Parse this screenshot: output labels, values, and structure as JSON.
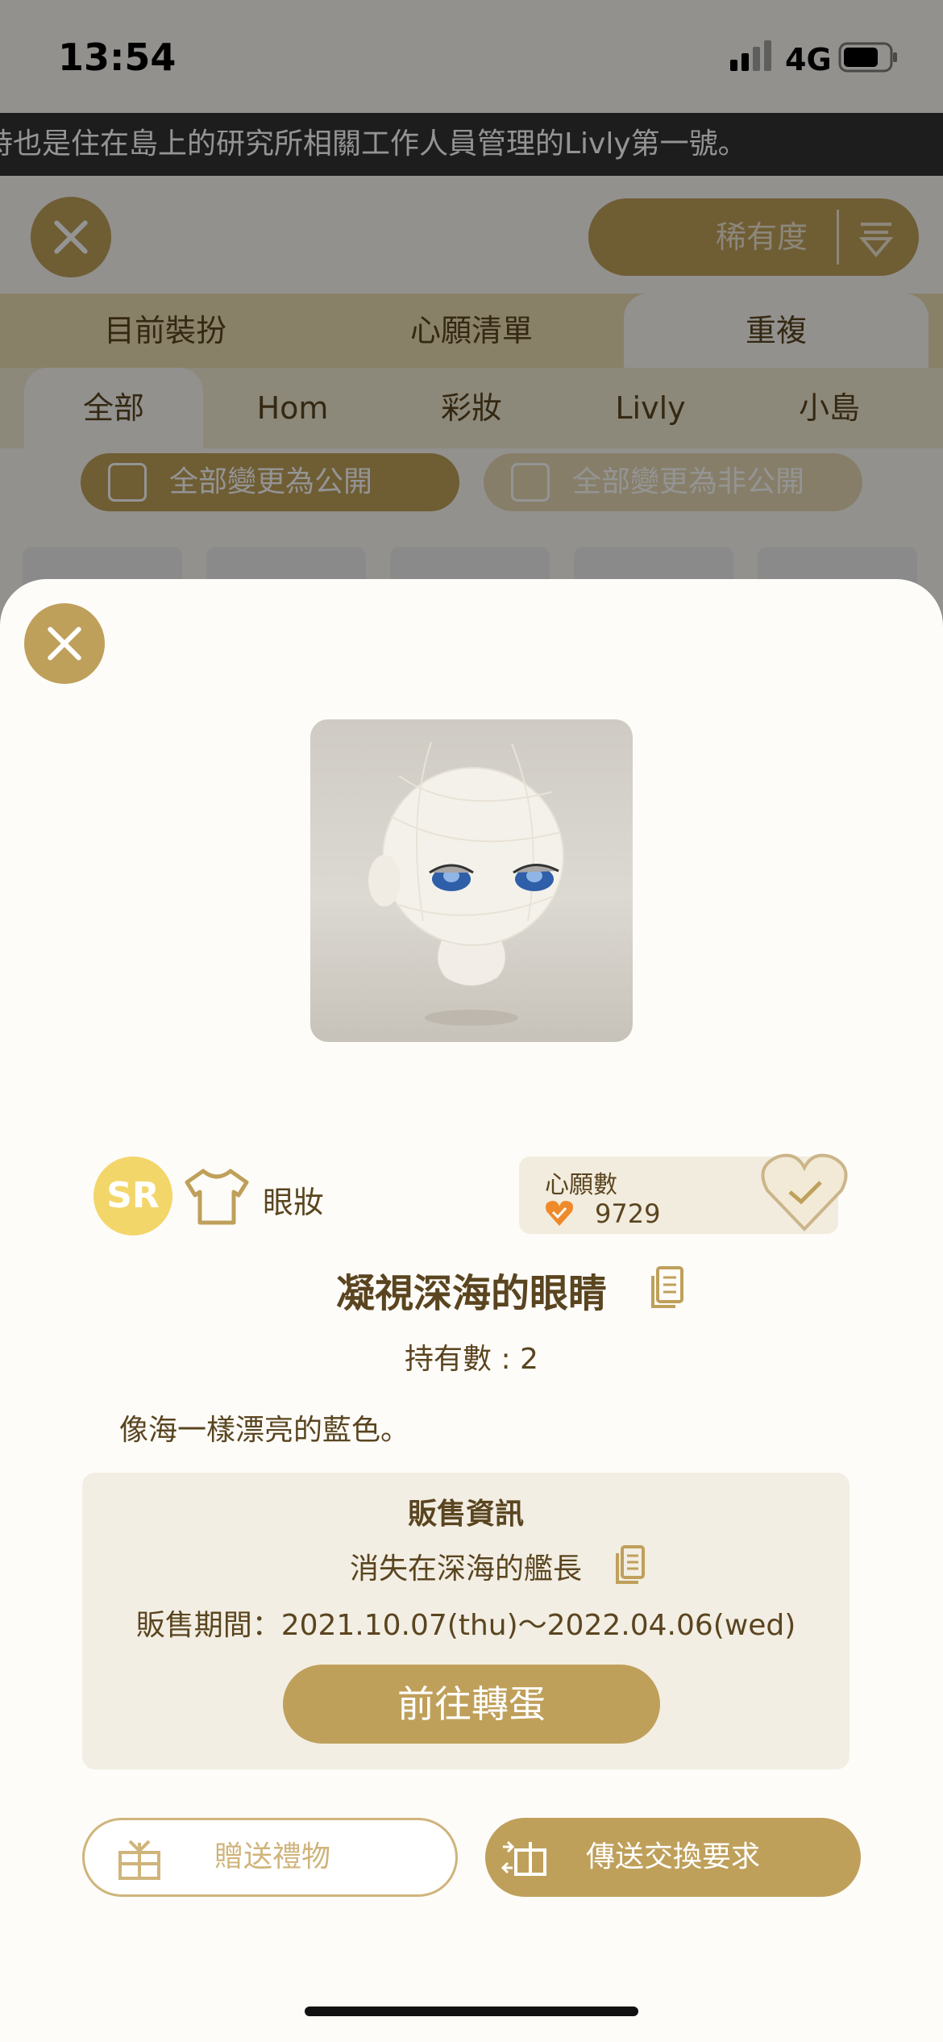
{
  "status_bar": {
    "time": "13:54",
    "network": "4G"
  },
  "ticker": {
    "text": "時也是住在島上的研究所相關工作人員管理的Livly第一號。"
  },
  "header": {
    "rarity_label": "稀有度"
  },
  "tabs_primary": [
    {
      "label": "目前裝扮",
      "active": false
    },
    {
      "label": "心願清單",
      "active": false
    },
    {
      "label": "重複",
      "active": true
    }
  ],
  "tabs_secondary": [
    {
      "label": "全部",
      "active": true
    },
    {
      "label": "Hom",
      "active": false
    },
    {
      "label": "彩妝",
      "active": false
    },
    {
      "label": "Livly",
      "active": false
    },
    {
      "label": "小島",
      "active": false
    }
  ],
  "visibility": {
    "make_public": "全部變更為公開",
    "make_private": "全部變更為非公開"
  },
  "item": {
    "rarity": "SR",
    "category": "眼妝",
    "wish_label": "心願數",
    "wish_count": "9729",
    "name": "凝視深海的眼睛",
    "owned": "持有數 : 2",
    "description": "像海一樣漂亮的藍色。"
  },
  "sale_info": {
    "title": "販售資訊",
    "gacha_name": "消失在深海的艦長",
    "period": "販售期間：2021.10.07(thu)〜2022.04.06(wed)",
    "go_button": "前往轉蛋"
  },
  "actions": {
    "gift": "贈送禮物",
    "trade": "傳送交換要求"
  },
  "colors": {
    "accent": "#bfa05b",
    "text": "#5a4520",
    "rarity_sr": "#f3d66a",
    "wish_heart": "#ef8a2b"
  }
}
